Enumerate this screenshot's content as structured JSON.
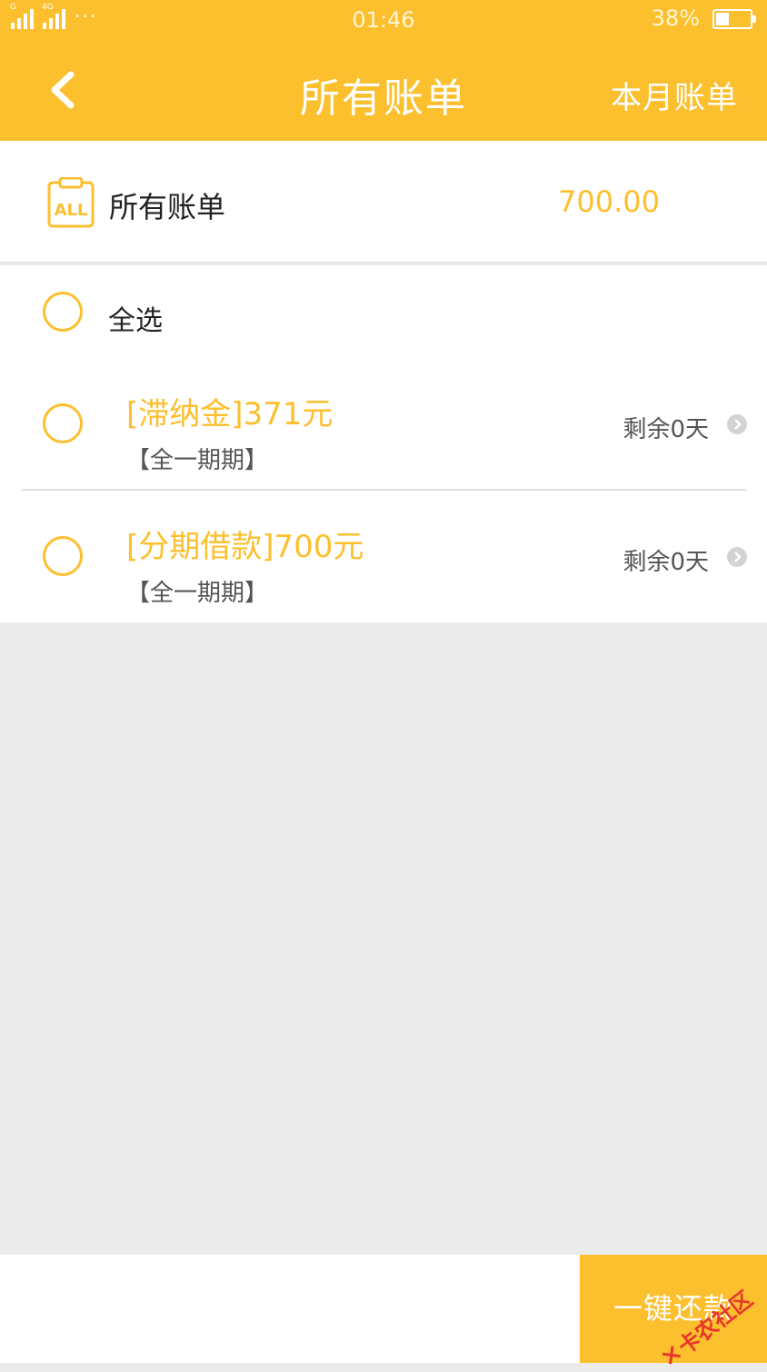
{
  "status_bar": {
    "sim1_tag": "G",
    "sim2_tag": "4G",
    "more": "···",
    "time": "01:46",
    "battery_percent": "38%",
    "battery_level": 0.38
  },
  "header": {
    "title": "所有账单",
    "month_link": "本月账单",
    "back_icon": "chevron-left-icon"
  },
  "summary": {
    "icon_text": "ALL",
    "label": "所有账单",
    "amount": "700.00"
  },
  "select_all": {
    "label": "全选"
  },
  "bills": [
    {
      "title": "[滞纳金]371元",
      "period": "【全一期期】",
      "remaining": "剩余0天"
    },
    {
      "title": "[分期借款]700元",
      "period": "【全一期期】",
      "remaining": "剩余0天"
    }
  ],
  "footer": {
    "pay_label": "一键还款",
    "watermark": "卡农社区"
  },
  "colors": {
    "accent": "#fcbf2d",
    "background": "#ebebeb",
    "watermark": "#e8362b"
  }
}
